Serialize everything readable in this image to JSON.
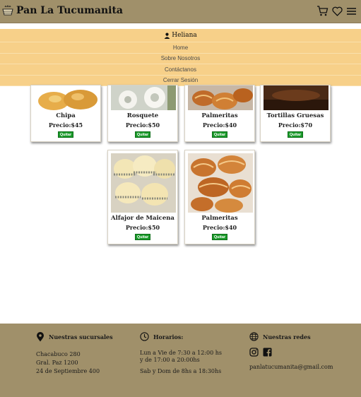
{
  "header": {
    "title": "Pan La Tucumanita",
    "icons": [
      "bread-basket-icon",
      "cart-icon",
      "heart-icon",
      "menu-icon"
    ]
  },
  "menu": {
    "user": "Heliana",
    "items": [
      "Home",
      "Sobre Nosotros",
      "Contáctanos",
      "Cerrar Sesión"
    ]
  },
  "products": [
    {
      "name": "Chipa",
      "price": "Precio:$45",
      "button": "Quitar"
    },
    {
      "name": "Rosquete",
      "price": "Precio:$50",
      "button": "Quitar"
    },
    {
      "name": "Palmeritas",
      "price": "Precio:$40",
      "button": "Quitar"
    },
    {
      "name": "Tortillas Gruesas",
      "price": "Precio:$70",
      "button": "Quitar"
    },
    {
      "name": "Alfajor de Maicena",
      "price": "Precio:$50",
      "button": "Quitar"
    },
    {
      "name": "Palmeritas",
      "price": "Precio:$40",
      "button": "Quitar"
    }
  ],
  "footer": {
    "branches": {
      "title": "Nuestras sucursales",
      "lines": [
        "Chacabuco 280",
        "Gral. Paz 1200",
        "24 de Septiembre 400"
      ]
    },
    "hours": {
      "title": "Horarios:",
      "lines": [
        "Lun a Vie de 7:30 a 12:00 hs",
        "y de 17:00 a 20:00hs",
        "Sab y Dom de 8hs a 18:30hs"
      ]
    },
    "social": {
      "title": "Nuestras redes",
      "email": "panlatucumanita@gmail.com"
    }
  },
  "colors": {
    "header_bg": "#a0906a",
    "menu_bg": "#f7d089",
    "button_green": "#1a9a2a"
  }
}
